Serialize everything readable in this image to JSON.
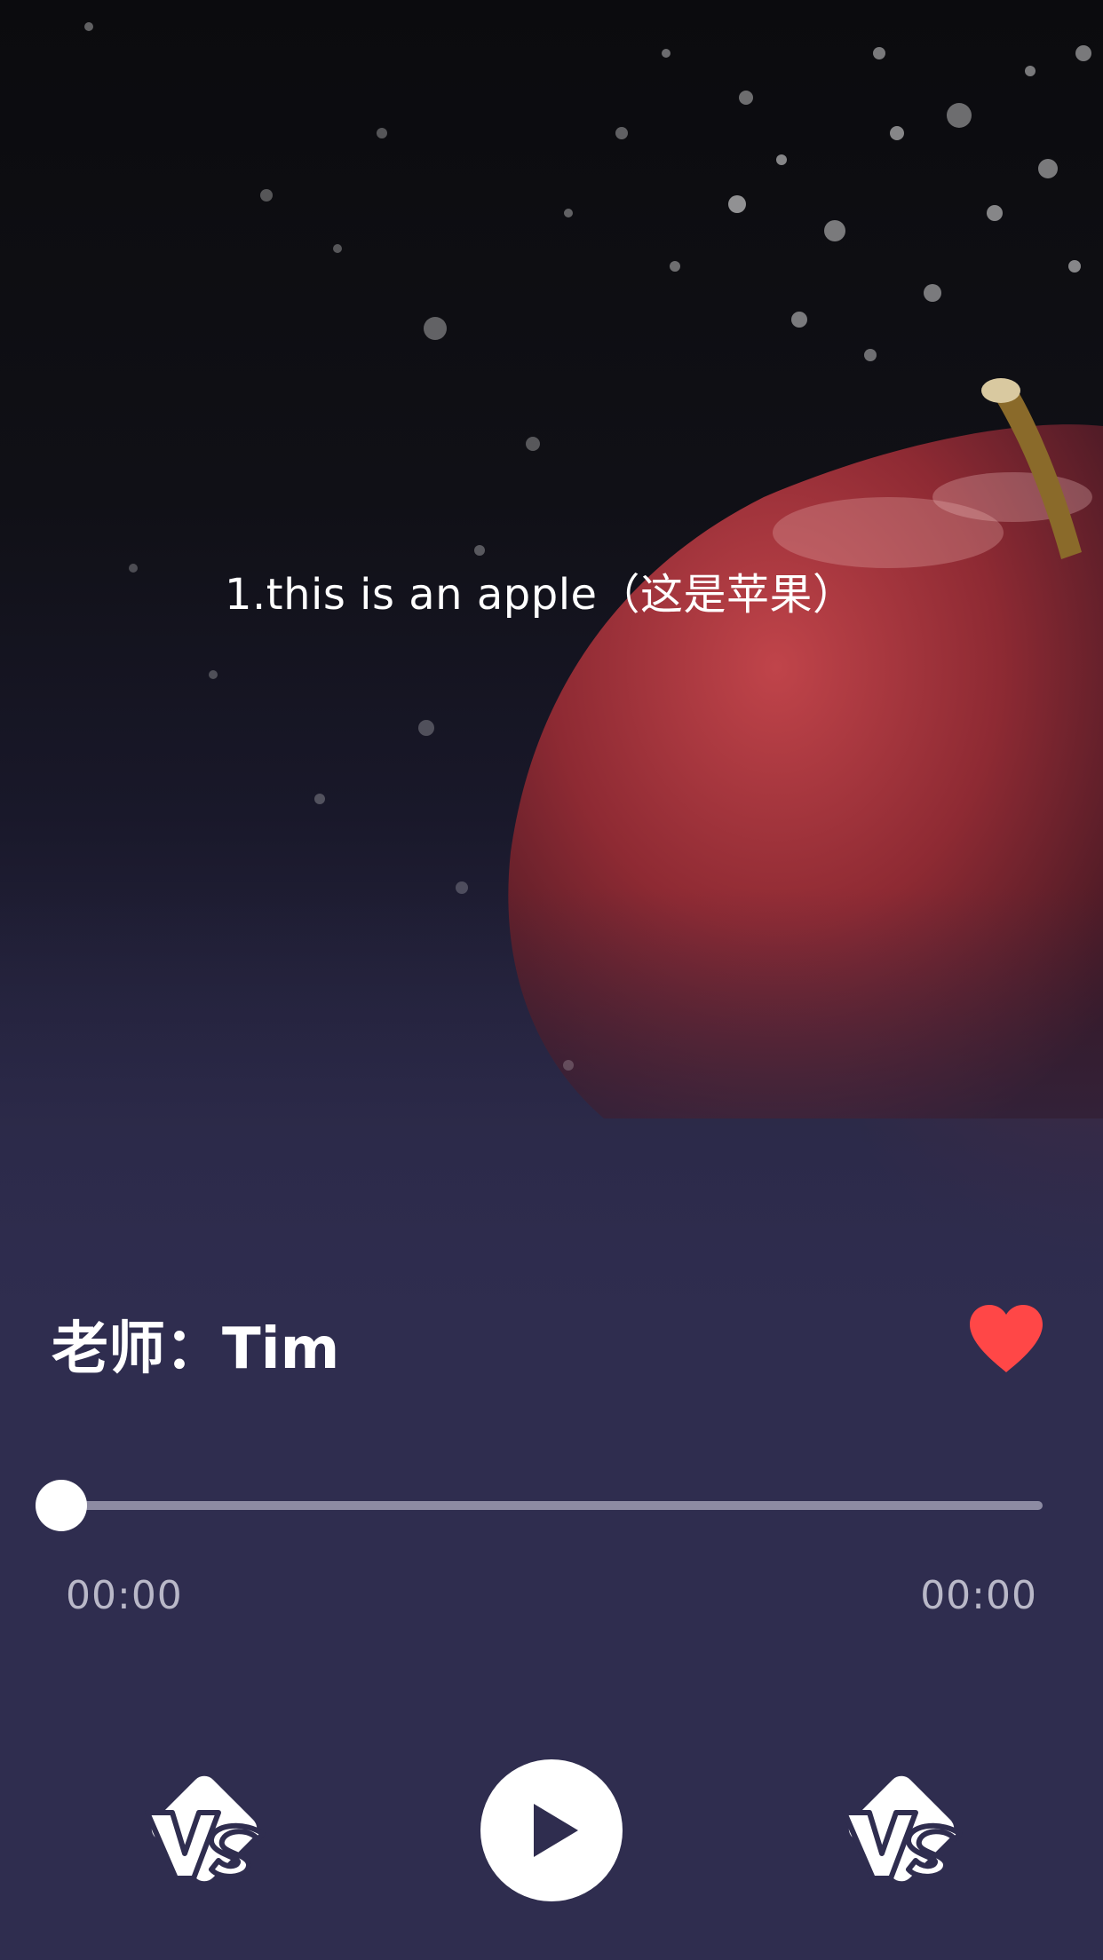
{
  "lyric": {
    "text": "1.this is an apple（这是苹果）"
  },
  "teacher": {
    "label": "老师：Tim"
  },
  "favorite": {
    "icon": "heart-icon",
    "color": "#ff4747",
    "active": true
  },
  "player": {
    "progress_fraction": 0,
    "current_time": "00:00",
    "total_time": "00:00",
    "prev_icon": "vs-icon",
    "play_icon": "play-icon",
    "next_icon": "vs-icon"
  },
  "colors": {
    "background": "#2f2d4f",
    "accent": "#ff4747"
  }
}
